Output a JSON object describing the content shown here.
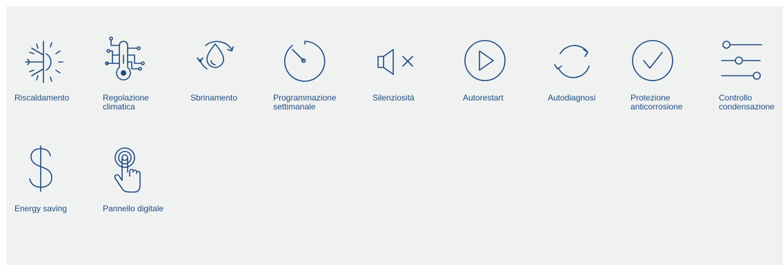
{
  "colors": {
    "panel_background": "#f0f2f2",
    "icon_and_text": "#1d4a80"
  },
  "features": [
    {
      "label": "Riscaldamento",
      "icon": "heating-snowflake-sun-icon"
    },
    {
      "label": "Regolazione\nclimatica",
      "icon": "thermometer-circuit-icon"
    },
    {
      "label": "Sbrinamento",
      "icon": "defrost-droplet-cycle-icon"
    },
    {
      "label": "Programmazione\nsettimanale",
      "icon": "weekly-timer-icon"
    },
    {
      "label": "Silenziosità",
      "icon": "speaker-muted-icon"
    },
    {
      "label": "Autorestart",
      "icon": "play-circle-icon"
    },
    {
      "label": "Autodiagnosi",
      "icon": "refresh-arrows-icon"
    },
    {
      "label": "Protezione\nanticorrosione",
      "icon": "checkmark-circle-icon"
    },
    {
      "label": "Controllo\ncondensazione",
      "icon": "sliders-icon"
    },
    {
      "label": "Energy saving",
      "icon": "dollar-sign-icon"
    },
    {
      "label": "Pannello digitale",
      "icon": "touch-finger-icon"
    }
  ]
}
